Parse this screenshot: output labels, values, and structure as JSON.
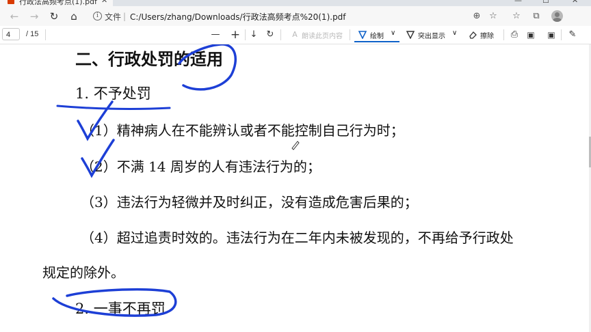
{
  "tab": {
    "title": "行政法高频考点(1).pdf",
    "close_glyph": "✕"
  },
  "window": {
    "minimize_glyph": "—",
    "maximize_glyph": "☐",
    "close_glyph": "✕"
  },
  "addressbar": {
    "back_glyph": "←",
    "forward_glyph": "→",
    "refresh_glyph": "↻",
    "home_glyph": "⌂",
    "info_glyph": "i",
    "file_label": "文件",
    "separator": "|",
    "url": "C:/Users/zhang/Downloads/行政法高频考点%20(1).pdf",
    "zoom_glyph": "⊕",
    "favorite_glyph": "☆",
    "favorites_bar_glyph": "☆",
    "collections_glyph": "⧉"
  },
  "pdf_toolbar": {
    "page_current": "4",
    "page_total": "/ 15",
    "zoom_out_glyph": "—",
    "zoom_in_glyph": "+",
    "fit_glyph": "↓",
    "rotate_glyph": "↻",
    "view_glyph": "⊟",
    "read_aloud_glyph": "A",
    "read_aloud_label": "朗读此页内容",
    "draw_label": "绘制",
    "highlight_label": "突出显示",
    "erase_label": "擦除",
    "dropdown_glyph": "∨",
    "print_glyph": "⎙",
    "save_glyph": "▣",
    "save_as_glyph": "▣",
    "pin_glyph": "✎"
  },
  "document": {
    "heading": "二、行政处罚的适用",
    "subheading_1": "1. 不予处罚",
    "items": [
      "（1）精神病人在不能辨认或者不能控制自己行为时；",
      "（2）不满 14 周岁的人有违法行为的；",
      "（3）违法行为轻微并及时纠正，没有造成危害后果的；",
      "（4）超过追责时效的。违法行为在二年内未被发现的，不再给予行政处"
    ],
    "continuation": "规定的除外。",
    "subheading_2": "2. 一事不再罚"
  },
  "colors": {
    "ink_blue": "#1d3fd6",
    "accent_blue": "#0f62c9",
    "tab_favicon": "#d83b01"
  }
}
